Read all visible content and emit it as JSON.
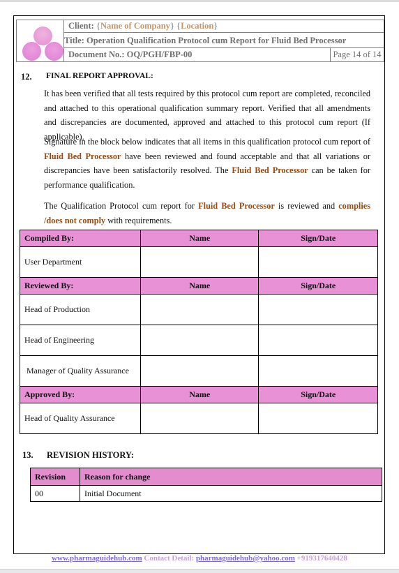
{
  "header": {
    "client_label": "Client: ",
    "client_open1": "{",
    "client_company": "Name of Company",
    "client_close1": "} {",
    "client_location": "Location",
    "client_close2": "}",
    "title": "Title: Operation Qualification Protocol cum Report for Fluid Bed Processor",
    "document_no": "Document No.: OQ/PGH/FBP-00",
    "page": "Page 14 of 14",
    "logo_icon": "three-circles-logo"
  },
  "section12": {
    "number": "12.",
    "heading": "FINAL REPORT APPROVAL:",
    "para1": "It has been verified that all tests required by this protocol cum report are completed, reconciled and attached to this operational qualification summary report. Verified that all amendments and discrepancies are documented, approved and attached to this protocol cum report (If applicable).",
    "para2_a": "Signature in the block below indicates that all items in this qualification protocol cum report of ",
    "para2_equip1": "Fluid Bed Processor",
    "para2_b": " have been reviewed and found acceptable and that all variations or discrepancies have been satisfactorily resolved. The ",
    "para2_equip2": "Fluid Bed Processor",
    "para2_c": " can be taken for performance qualification.",
    "para3_a": "The Qualification Protocol cum report for ",
    "para3_equip": "Fluid Bed Processor",
    "para3_b": " is reviewed and ",
    "para3_status": "complies /does not comply",
    "para3_c": " with requirements."
  },
  "approval_table": {
    "name_header": "Name",
    "sign_header": "Sign/Date",
    "groups": [
      {
        "header": "Compiled By:",
        "rows": [
          "User Department"
        ]
      },
      {
        "header": "Reviewed By:",
        "rows": [
          "Head of Production",
          "Head of Engineering",
          " Manager of Quality Assurance"
        ]
      },
      {
        "header": "Approved By:",
        "rows": [
          "Head of Quality Assurance"
        ]
      }
    ]
  },
  "section13": {
    "number": "13.",
    "heading": "REVISION HISTORY:",
    "columns": [
      "Revision",
      "Reason for change"
    ],
    "rows": [
      [
        "00",
        "Initial Document"
      ]
    ]
  },
  "footer": {
    "website": "www.pharmaguidehub.com",
    "contact_label": " Contact Detail: ",
    "email": "pharmaguidehub@yahoo.com",
    "phone": " +919317640428"
  },
  "colors": {
    "table_header_pink": "#e891d6",
    "equipment_brown": "#9a4a10",
    "placeholder_tan": "#c8946a",
    "footer_link": "#7b6ae0"
  }
}
